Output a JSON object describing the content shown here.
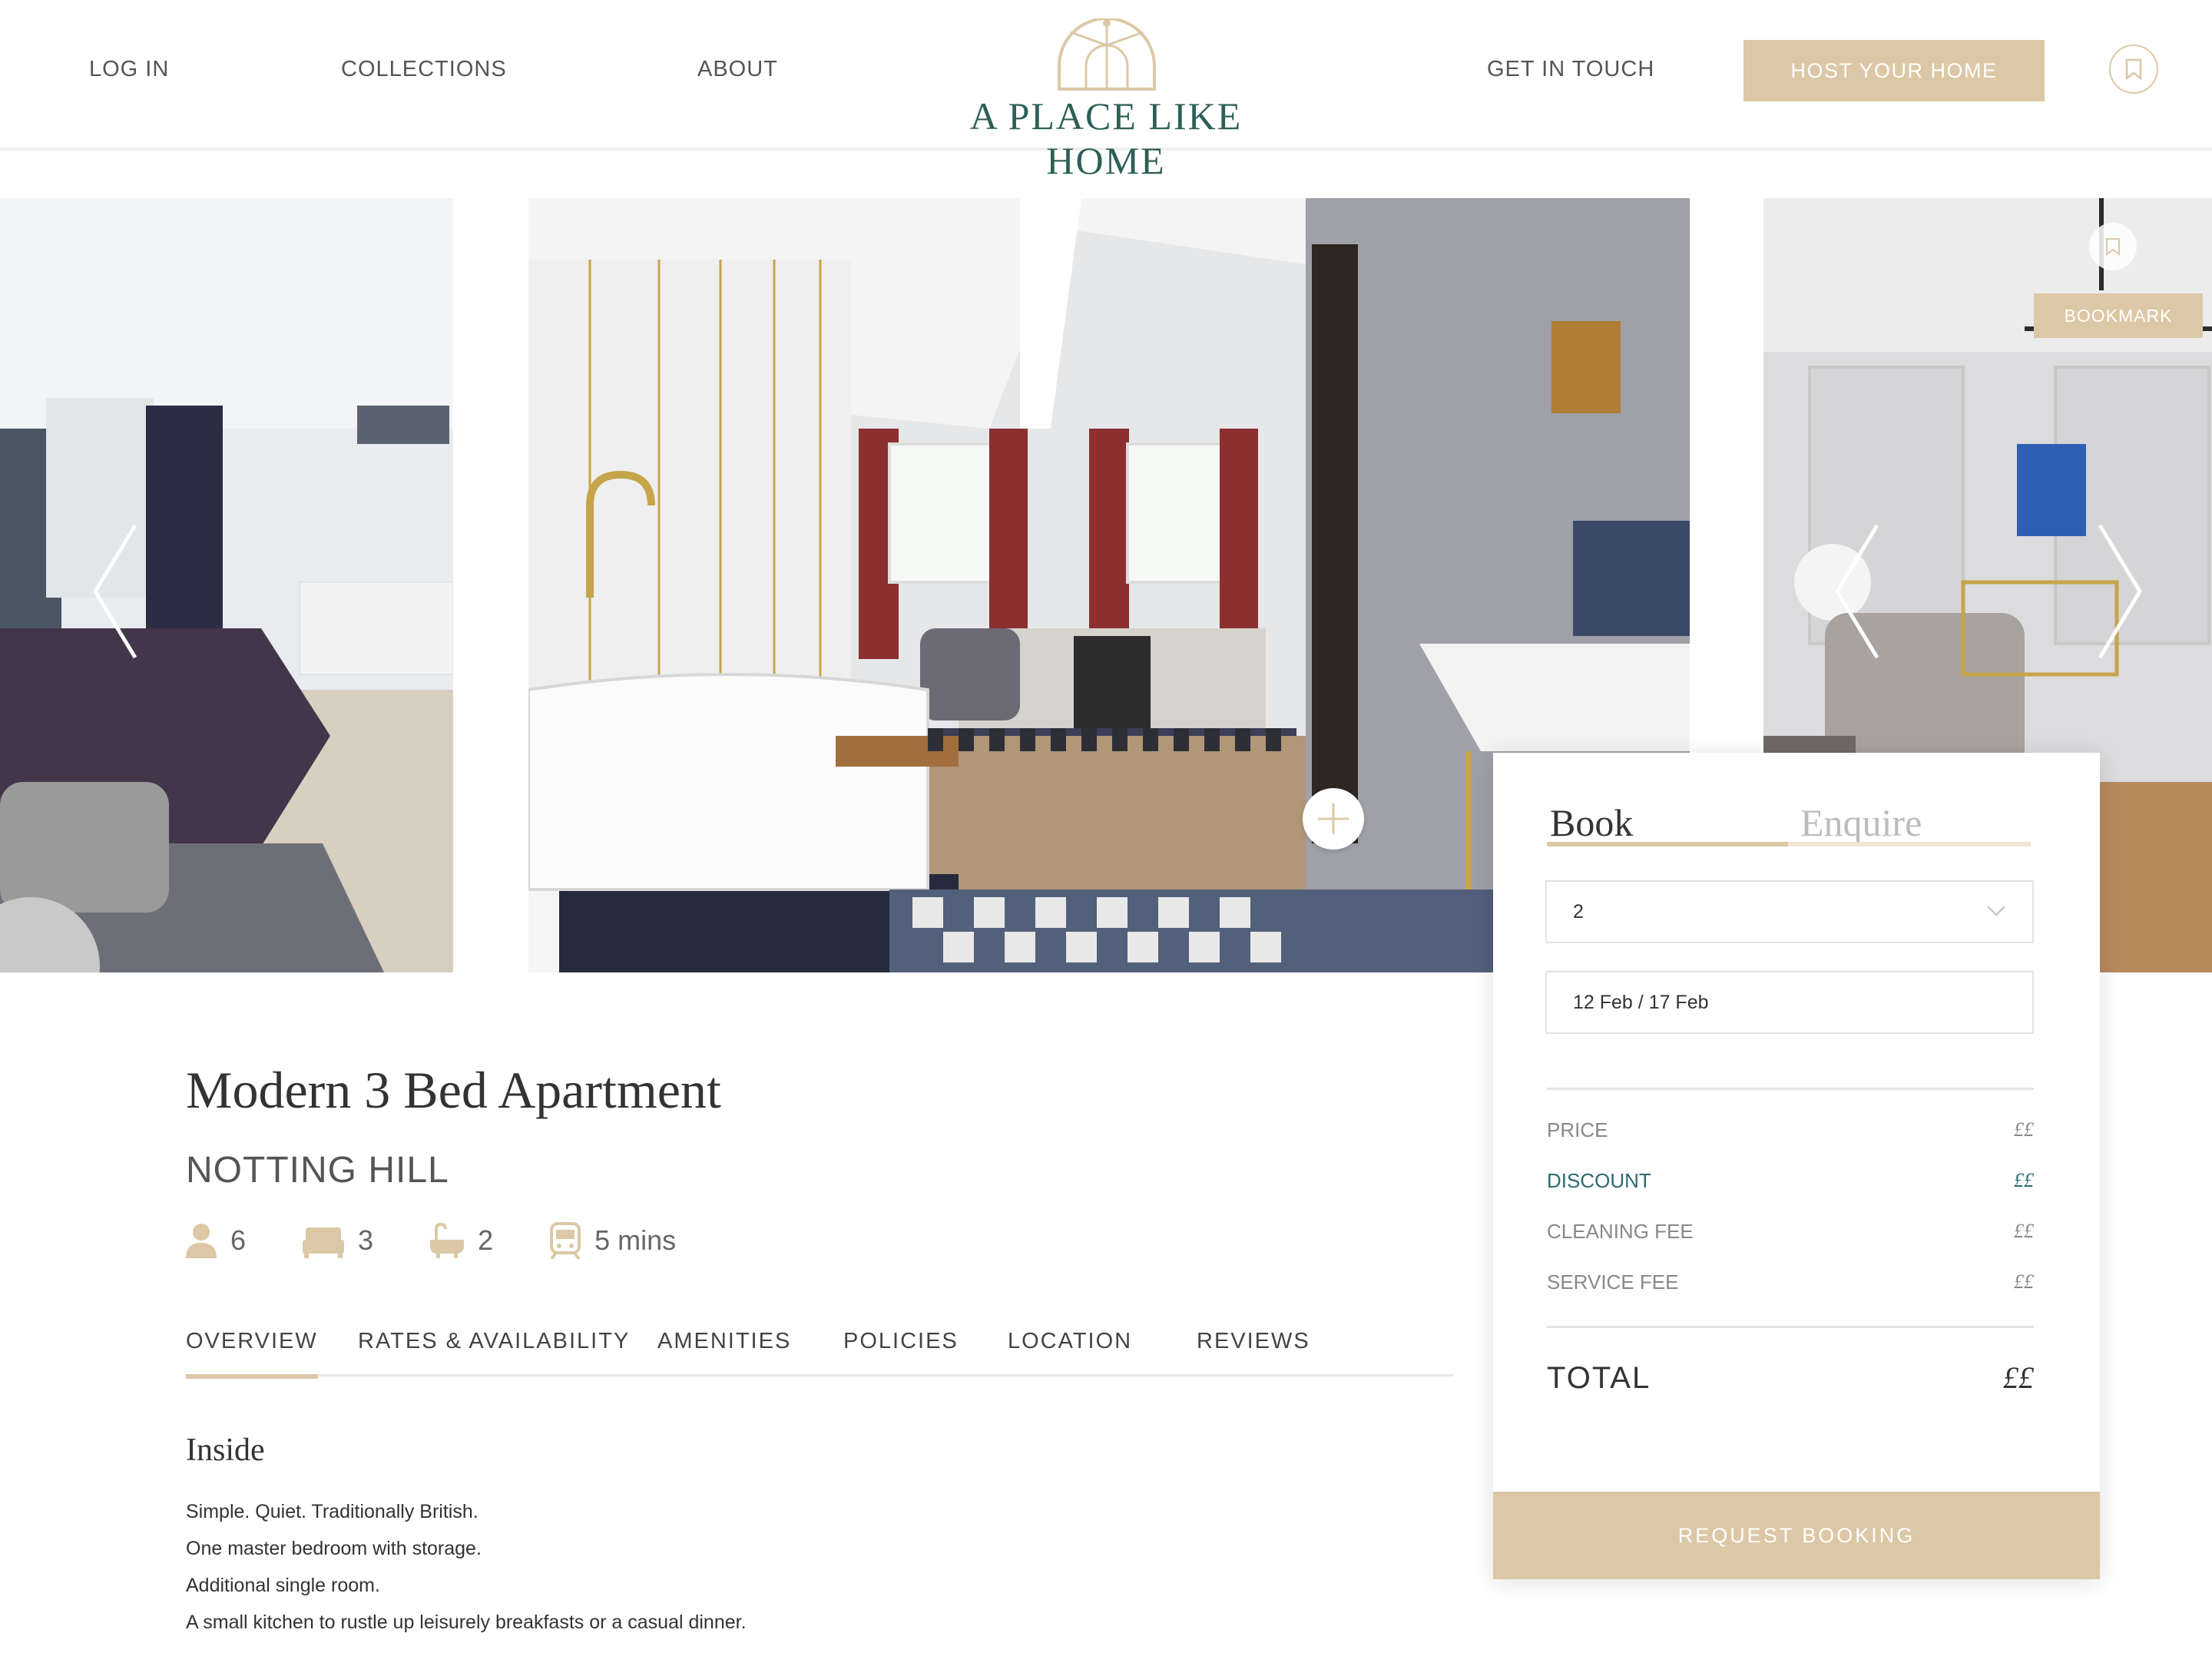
{
  "header": {
    "nav_left": [
      "LOG IN",
      "COLLECTIONS",
      "ABOUT"
    ],
    "logo_text": "A PLACE LIKE HOME",
    "nav_right": "GET IN TOUCH",
    "host_button": "HOST YOUR HOME"
  },
  "gallery": {
    "bookmark_label": "BOOKMARK"
  },
  "listing": {
    "title": "Modern 3 Bed Apartment",
    "area": "NOTTING HILL",
    "features": {
      "guests": "6",
      "bedrooms": "3",
      "bathrooms": "2",
      "transport": "5 mins"
    }
  },
  "tabs": [
    "OVERVIEW",
    "RATES & AVAILABILITY",
    "AMENITIES",
    "POLICIES",
    "LOCATION",
    "REVIEWS"
  ],
  "overview": {
    "heading": "Inside",
    "lines": [
      "Simple. Quiet. Traditionally British.",
      "One master bedroom with storage.",
      "Additional single room.",
      "A small kitchen to rustle up leisurely breakfasts or a casual dinner."
    ]
  },
  "booking": {
    "tab_book": "Book",
    "tab_enquire": "Enquire",
    "guests_value": "2",
    "dates_value": "12 Feb / 17 Feb",
    "fees": [
      {
        "label": "PRICE",
        "value": "££"
      },
      {
        "label": "DISCOUNT",
        "value": "££"
      },
      {
        "label": "CLEANING FEE",
        "value": "££"
      },
      {
        "label": "SERVICE FEE",
        "value": "££"
      }
    ],
    "total_label": "TOTAL",
    "total_value": "££",
    "request_button": "REQUEST BOOKING"
  },
  "colors": {
    "accent": "#dcc8a6",
    "brand_green": "#2d5f57",
    "discount": "#2d6a70"
  }
}
